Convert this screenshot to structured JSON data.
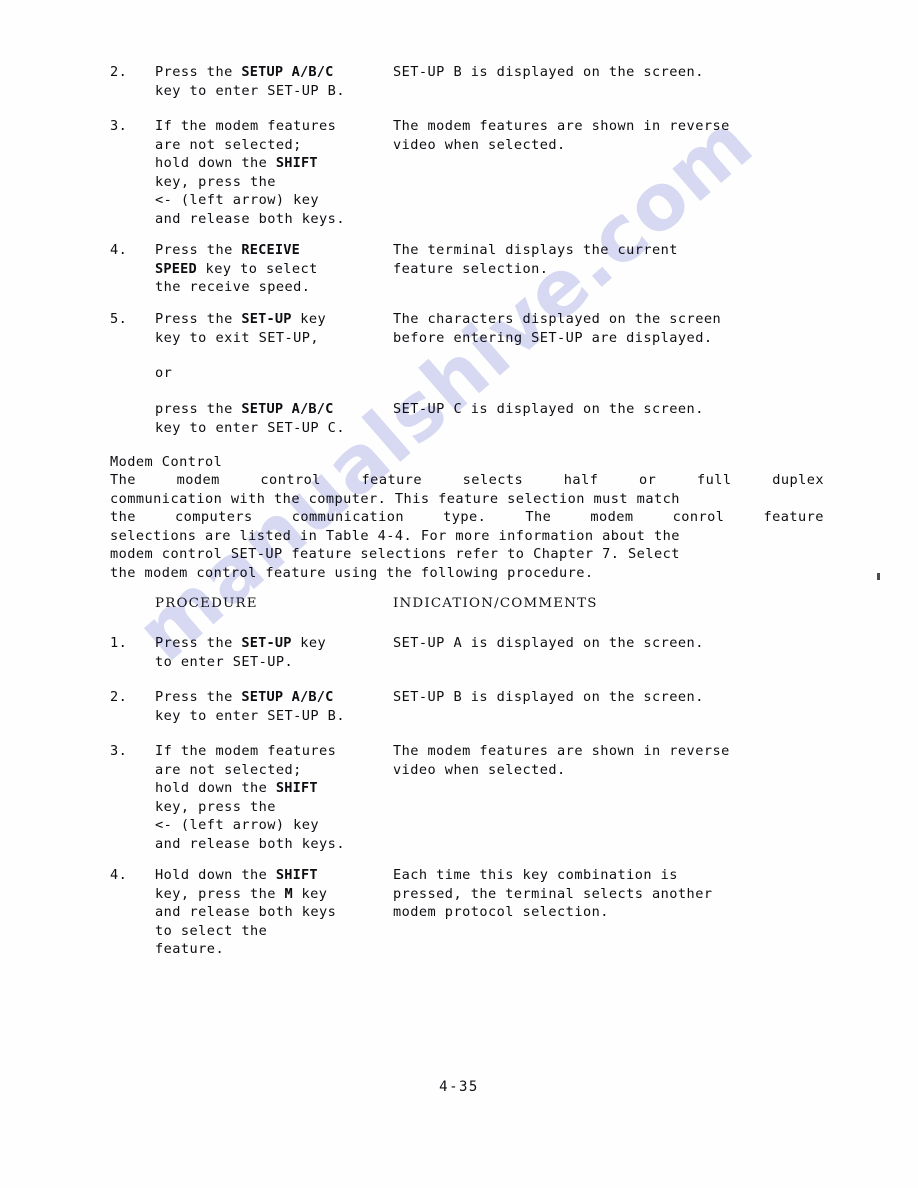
{
  "document": {
    "page_number": "4-35",
    "watermark_text": "manualshive.com",
    "watermark_color": "#c9cbee"
  },
  "top_steps": [
    {
      "number": "2.",
      "procedure_lines": [
        [
          {
            "t": "Press the ",
            "b": false
          },
          {
            "t": "SETUP A/B/C",
            "b": true
          }
        ],
        [
          {
            "t": "key to enter SET-UP B.",
            "b": false
          }
        ]
      ],
      "indication_lines": [
        "SET-UP B is displayed on the screen."
      ]
    },
    {
      "number": "3.",
      "procedure_lines": [
        [
          {
            "t": "If the modem features",
            "b": false
          }
        ],
        [
          {
            "t": "are not selected;",
            "b": false
          }
        ],
        [
          {
            "t": "hold down the ",
            "b": false
          },
          {
            "t": "SHIFT",
            "b": true
          }
        ],
        [
          {
            "t": "key, press the",
            "b": false
          }
        ],
        [
          {
            "t": "<- (left arrow) key",
            "b": false
          }
        ],
        [
          {
            "t": "and release both keys.",
            "b": false
          }
        ]
      ],
      "indication_lines": [
        "The modem features are shown in reverse",
        "video when selected."
      ]
    },
    {
      "number": "4.",
      "procedure_lines": [
        [
          {
            "t": "Press the ",
            "b": false
          },
          {
            "t": "RECEIVE",
            "b": true
          }
        ],
        [
          {
            "t": "SPEED",
            "b": true
          },
          {
            "t": " key to select",
            "b": false
          }
        ],
        [
          {
            "t": "the receive speed.",
            "b": false
          }
        ]
      ],
      "indication_lines": [
        "The terminal displays the current",
        "feature selection."
      ]
    },
    {
      "number": "5.",
      "procedure_lines": [
        [
          {
            "t": "Press the ",
            "b": false
          },
          {
            "t": "SET-UP",
            "b": true
          },
          {
            "t": " key",
            "b": false
          }
        ],
        [
          {
            "t": "key to exit SET-UP,",
            "b": false
          }
        ]
      ],
      "indication_lines": [
        "The characters displayed on the screen",
        "before entering SET-UP are displayed."
      ]
    }
  ],
  "or_text": "or",
  "alt_step": {
    "procedure_lines": [
      [
        {
          "t": "press the ",
          "b": false
        },
        {
          "t": "SETUP A/B/C",
          "b": true
        }
      ],
      [
        {
          "t": "key to enter SET-UP C.",
          "b": false
        }
      ]
    ],
    "indication_lines": [
      "SET-UP C is displayed on the screen."
    ]
  },
  "section": {
    "heading": "Modem Control",
    "paragraph_lines": [
      {
        "justified": true,
        "words": [
          "The",
          "modem",
          "control",
          "feature",
          "selects",
          "half",
          "or",
          "full",
          "duplex"
        ]
      },
      {
        "justified": false,
        "text": "communication with the computer. This feature selection must match"
      },
      {
        "justified": true,
        "words": [
          "the",
          "computers",
          "communication",
          "type.",
          "The",
          "modem",
          "conrol",
          "feature"
        ]
      },
      {
        "justified": false,
        "text": "selections are listed in Table 4-4. For more information about the"
      },
      {
        "justified": false,
        "text": "modem control SET-UP feature selections refer to Chapter 7. Select"
      },
      {
        "justified": false,
        "text": "the modem control feature using the following procedure."
      }
    ]
  },
  "column_headers": {
    "procedure": "PROCEDURE",
    "indication": "INDICATION/COMMENTS"
  },
  "bottom_steps": [
    {
      "number": "1.",
      "procedure_lines": [
        [
          {
            "t": "Press the ",
            "b": false
          },
          {
            "t": "SET-UP",
            "b": true
          },
          {
            "t": " key",
            "b": false
          }
        ],
        [
          {
            "t": "to enter SET-UP.",
            "b": false
          }
        ]
      ],
      "indication_lines": [
        "SET-UP A is displayed on the screen."
      ]
    },
    {
      "number": "2.",
      "procedure_lines": [
        [
          {
            "t": "Press the ",
            "b": false
          },
          {
            "t": "SETUP A/B/C",
            "b": true
          }
        ],
        [
          {
            "t": "key to enter SET-UP B.",
            "b": false
          }
        ]
      ],
      "indication_lines": [
        "SET-UP B is displayed on the screen."
      ]
    },
    {
      "number": "3.",
      "procedure_lines": [
        [
          {
            "t": "If the modem features",
            "b": false
          }
        ],
        [
          {
            "t": "are not selected;",
            "b": false
          }
        ],
        [
          {
            "t": "hold down the ",
            "b": false
          },
          {
            "t": "SHIFT",
            "b": true
          }
        ],
        [
          {
            "t": "key, press the",
            "b": false
          }
        ],
        [
          {
            "t": "<- (left arrow) key",
            "b": false
          }
        ],
        [
          {
            "t": "and release both keys.",
            "b": false
          }
        ]
      ],
      "indication_lines": [
        "The modem features are shown in reverse",
        "video when selected."
      ]
    },
    {
      "number": "4.",
      "procedure_lines": [
        [
          {
            "t": "Hold down the ",
            "b": false
          },
          {
            "t": "SHIFT",
            "b": true
          }
        ],
        [
          {
            "t": "key, press the ",
            "b": false
          },
          {
            "t": "M",
            "b": true
          },
          {
            "t": " key",
            "b": false
          }
        ],
        [
          {
            "t": "and release both keys",
            "b": false
          }
        ],
        [
          {
            "t": "to select the",
            "b": false
          }
        ],
        [
          {
            "t": "feature.",
            "b": false
          }
        ]
      ],
      "indication_lines": [
        "Each time this key combination is",
        "pressed, the terminal selects another",
        "modem protocol selection."
      ]
    }
  ]
}
